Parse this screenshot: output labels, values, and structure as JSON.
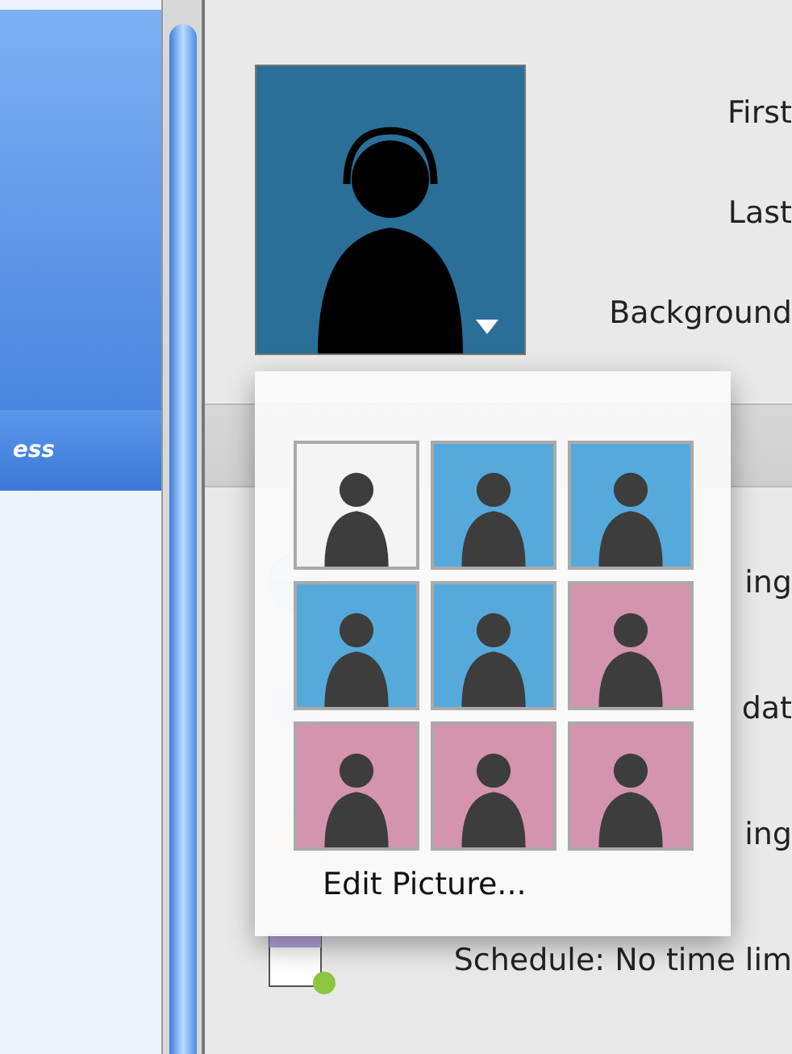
{
  "sidebar": {
    "items": [
      {
        "label": "ess",
        "selected": true
      }
    ]
  },
  "account": {
    "field_labels": [
      "First",
      "Last",
      "Background"
    ]
  },
  "list": [
    {
      "kind": "web",
      "text": "ing"
    },
    {
      "kind": "chat",
      "text": "dat"
    },
    {
      "kind": "mail",
      "text": "ing"
    },
    {
      "kind": "schedule",
      "text": "Schedule:  No time lim"
    }
  ],
  "picture_menu": {
    "pictures": [
      {
        "color": "#f4f4f4"
      },
      {
        "color": "#55aadb"
      },
      {
        "color": "#55aadb"
      },
      {
        "color": "#55aadb"
      },
      {
        "color": "#55aadb"
      },
      {
        "color": "#d494ae"
      },
      {
        "color": "#d494ae"
      },
      {
        "color": "#d494ae"
      },
      {
        "color": "#d494ae"
      }
    ],
    "action": "Edit Picture..."
  }
}
